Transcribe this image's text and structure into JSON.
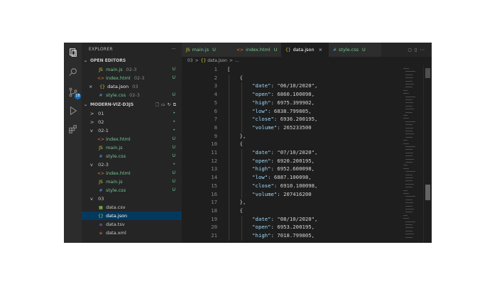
{
  "sidebar": {
    "title": "EXPLORER",
    "more": "···",
    "open_editors": {
      "label": "OPEN EDITORS",
      "items": [
        {
          "icon": "JS",
          "name": "main.js",
          "path": "02-3",
          "status": "U"
        },
        {
          "icon": "<>",
          "name": "index.html",
          "path": "02-3",
          "status": "U"
        },
        {
          "icon": "{}",
          "name": "data.json",
          "path": "03",
          "status": ""
        },
        {
          "icon": "#",
          "name": "style.css",
          "path": "02-3",
          "status": "U"
        }
      ]
    },
    "project": {
      "label": "MODERN-VIZ-D3JS",
      "tree": [
        {
          "label": "01",
          "chevron": ">",
          "status": "•"
        },
        {
          "label": "02",
          "chevron": ">",
          "status": "•"
        },
        {
          "label": "02-1",
          "chevron": "v",
          "status": "•"
        },
        {
          "label": "index.html",
          "icon": "<>",
          "status": "U"
        },
        {
          "label": "main.js",
          "icon": "JS",
          "status": "U"
        },
        {
          "label": "style.css",
          "icon": "#",
          "status": "U"
        },
        {
          "label": "02-3",
          "chevron": "v",
          "status": "•"
        },
        {
          "label": "index.html",
          "icon": "<>",
          "status": "U"
        },
        {
          "label": "main.js",
          "icon": "JS",
          "status": "U"
        },
        {
          "label": "style.css",
          "icon": "#",
          "status": "U"
        },
        {
          "label": "03",
          "chevron": "v",
          "status": ""
        },
        {
          "label": "data.csv",
          "icon": "▦",
          "status": ""
        },
        {
          "label": "data.json",
          "icon": "{}",
          "status": ""
        },
        {
          "label": "data.tsv",
          "icon": "≡",
          "status": ""
        },
        {
          "label": "data.xml",
          "icon": "≡",
          "status": ""
        }
      ]
    }
  },
  "tabs": [
    {
      "icon": "JS",
      "label": "main.js",
      "status": "U"
    },
    {
      "icon": "<>",
      "label": "index.html",
      "status": "U"
    },
    {
      "icon": "{}",
      "label": "data.json",
      "close": "×"
    },
    {
      "icon": "#",
      "label": "style.css",
      "status": "U"
    }
  ],
  "breadcrumb": {
    "folder": "03",
    "sep": ">",
    "file_icon": "{}",
    "file": "data.json",
    "sep2": ">",
    "more": "..."
  },
  "editor": {
    "line_numbers": [
      "1",
      "2",
      "3",
      "4",
      "5",
      "6",
      "7",
      "8",
      "9",
      "10",
      "11",
      "12",
      "13",
      "14",
      "15",
      "16",
      "17",
      "18",
      "19",
      "20",
      "21"
    ],
    "lines": [
      "[",
      "    {",
      "        \"date\": \"06/10/2020\",",
      "        \"open\": 6860.100098,",
      "        \"high\": 6975.399902,",
      "        \"low\": 6838.799805,",
      "        \"close\": 6936.200195,",
      "        \"volume\": 265233500",
      "    },",
      "    {",
      "        \"date\": \"07/10/2020\",",
      "        \"open\": 6920.200195,",
      "        \"high\": 6952.600098,",
      "        \"low\": 6887.100098,",
      "        \"close\": 6910.100098,",
      "        \"volume\": 207416200",
      "    },",
      "    {",
      "        \"date\": \"08/10/2020\",",
      "        \"open\": 6953.200195,",
      "        \"high\": 7018.799805,"
    ]
  },
  "colors": {
    "accent": "#0e70c0",
    "key": "#9cdcfe",
    "string": "#ce9178",
    "number": "#b5cea8"
  }
}
